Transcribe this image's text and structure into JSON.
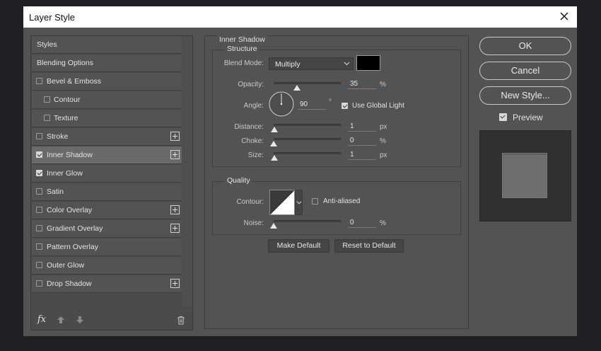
{
  "dialog": {
    "title": "Layer Style"
  },
  "sidebar": {
    "items": [
      {
        "label": "Styles"
      },
      {
        "label": "Blending Options"
      },
      {
        "label": "Bevel & Emboss"
      },
      {
        "label": "Contour"
      },
      {
        "label": "Texture"
      },
      {
        "label": "Stroke"
      },
      {
        "label": "Inner Shadow"
      },
      {
        "label": "Inner Glow"
      },
      {
        "label": "Satin"
      },
      {
        "label": "Color Overlay"
      },
      {
        "label": "Gradient Overlay"
      },
      {
        "label": "Pattern Overlay"
      },
      {
        "label": "Outer Glow"
      },
      {
        "label": "Drop Shadow"
      }
    ],
    "fx_label": "fx"
  },
  "panel": {
    "title": "Inner Shadow",
    "structure": {
      "title": "Structure",
      "blend_mode_label": "Blend Mode:",
      "blend_mode_value": "Multiply",
      "shadow_color": "#000000",
      "opacity_label": "Opacity:",
      "opacity_value": "35",
      "opacity_fraction": 0.35,
      "angle_label": "Angle:",
      "angle_value": "90",
      "degree_sign": "°",
      "use_global_light_label": "Use Global Light",
      "use_global_light_checked": true,
      "distance_label": "Distance:",
      "distance_value": "1",
      "choke_label": "Choke:",
      "choke_value": "0",
      "size_label": "Size:",
      "size_value": "1",
      "percent": "%",
      "px": "px"
    },
    "quality": {
      "title": "Quality",
      "contour_label": "Contour:",
      "anti_aliased_label": "Anti-aliased",
      "anti_aliased_checked": false,
      "noise_label": "Noise:",
      "noise_value": "0",
      "percent": "%"
    },
    "make_default_label": "Make Default",
    "reset_default_label": "Reset to Default"
  },
  "actions": {
    "ok_label": "OK",
    "cancel_label": "Cancel",
    "new_style_label": "New Style...",
    "preview_label": "Preview",
    "preview_checked": true
  },
  "colors": {
    "accent_underline": "#3b8fd9",
    "dialog_bg": "#535353",
    "selected_item_bg": "#6a6a6a"
  }
}
